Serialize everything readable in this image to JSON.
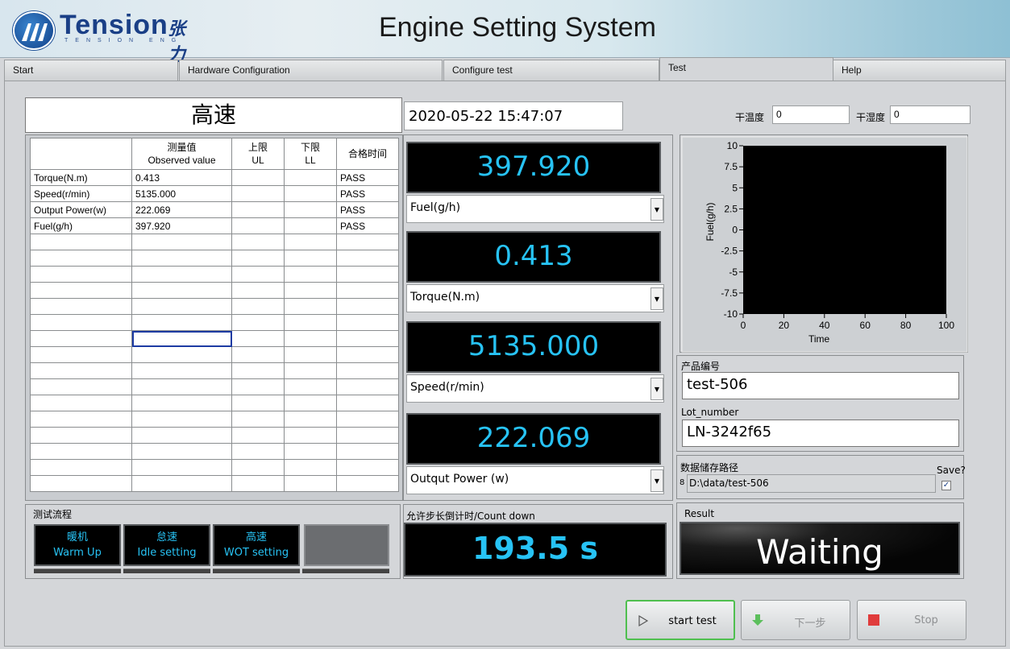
{
  "header": {
    "logo_text": "Tension",
    "logo_cn": "张力",
    "logo_sub": "TENSION ENG",
    "title": "Engine Setting System"
  },
  "tabs": [
    {
      "label": "Start",
      "active": false
    },
    {
      "label": "Hardware Configuration",
      "active": false
    },
    {
      "label": "Configure test",
      "active": false
    },
    {
      "label": "Test",
      "active": true
    },
    {
      "label": "Help",
      "active": false
    }
  ],
  "mode": "高速",
  "datetime": "2020-05-22 15:47:07",
  "env": {
    "dry_temp_label": "干温度",
    "dry_temp_value": "0",
    "dry_humidity_label": "干湿度",
    "dry_humidity_value": "0"
  },
  "table": {
    "headers": [
      {
        "line1": "",
        "line2": ""
      },
      {
        "line1": "测量值",
        "line2": "Observed value"
      },
      {
        "line1": "上限",
        "line2": "UL"
      },
      {
        "line1": "下限",
        "line2": "LL"
      },
      {
        "line1": "合格时间",
        "line2": ""
      }
    ],
    "rows": [
      [
        "Torque(N.m)",
        "0.413",
        "",
        "",
        "PASS"
      ],
      [
        "Speed(r/min)",
        "5135.000",
        "",
        "",
        "PASS"
      ],
      [
        "Output Power(w)",
        "222.069",
        "",
        "",
        "PASS"
      ],
      [
        "Fuel(g/h)",
        "397.920",
        "",
        "",
        "PASS"
      ]
    ],
    "empty_rows": 16
  },
  "readings": [
    {
      "value": "397.920",
      "selector": "Fuel(g/h)"
    },
    {
      "value": "0.413",
      "selector": "Torque(N.m)"
    },
    {
      "value": "5135.000",
      "selector": "Speed(r/min)"
    },
    {
      "value": "222.069",
      "selector": "Outqut Power (w)"
    }
  ],
  "chart_data": {
    "type": "line",
    "xlabel": "Time",
    "ylabel": "Fuel(g/h)",
    "xlim": [
      0,
      100
    ],
    "ylim": [
      -10,
      10
    ],
    "x_ticks": [
      "0",
      "20",
      "40",
      "60",
      "80",
      "100"
    ],
    "y_ticks": [
      "10",
      "7.5",
      "5",
      "2.5",
      "0",
      "-2.5",
      "-5",
      "-7.5",
      "-10"
    ],
    "series": []
  },
  "product": {
    "number_label": "产品编号",
    "number_value": "test-506",
    "lot_label": "Lot_number",
    "lot_value": "LN-3242f65"
  },
  "storage": {
    "label": "数据储存路径",
    "path": "D:\\data/test-506",
    "save_label": "Save?",
    "save_checked": "✓",
    "path_prefix": "8"
  },
  "process": {
    "label": "测试流程",
    "steps": [
      {
        "cn": "暖机",
        "en": "Warm Up"
      },
      {
        "cn": "怠速",
        "en": "Idle setting"
      },
      {
        "cn": "高速",
        "en": "WOT setting"
      },
      {
        "cn": "",
        "en": ""
      }
    ]
  },
  "countdown": {
    "label": "允许步长倒计时/Count down",
    "value": "193.5  s"
  },
  "result": {
    "label": "Result",
    "value": "Waiting"
  },
  "buttons": {
    "start": "start test",
    "next": "下一步",
    "stop": "Stop"
  },
  "colors": {
    "display_text": "#27c3f5",
    "display_bg": "#000000",
    "primary_border": "#4fbf4f",
    "stop_icon": "#e03c3c",
    "next_icon": "#5cbf5c"
  }
}
